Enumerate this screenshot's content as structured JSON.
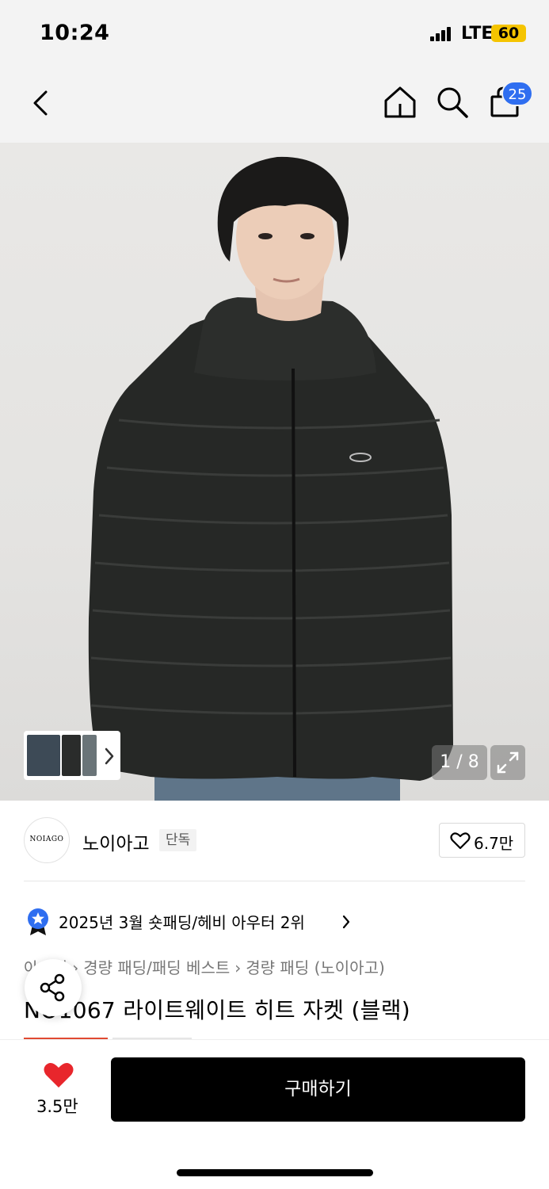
{
  "status_bar": {
    "time": "10:24",
    "network": "LTE",
    "battery": "60",
    "icons": [
      "signal-icon",
      "battery-icon"
    ]
  },
  "nav": {
    "icons": [
      "back-icon",
      "home-icon",
      "search-icon",
      "shopping-bag-icon"
    ],
    "cart_count": "25"
  },
  "gallery": {
    "counter": "1 / 8",
    "icons": [
      "chevron-right-icon",
      "expand-icon"
    ]
  },
  "brand": {
    "logo_text": "NOIAGO",
    "name": "노이아고",
    "tag": "단독",
    "likes": "6.7만"
  },
  "ranking": {
    "text": "2025년 3월 숏패딩/헤비 아우터 2위",
    "icon": "ribbon-badge-icon"
  },
  "breadcrumb": {
    "items": [
      "아우터",
      "경량 패딩/패딩 베스트",
      "경량 패딩 (노이아고)"
    ]
  },
  "product": {
    "title": "NO1067 라이트웨이트 히트 자켓 (블랙)"
  },
  "bottom_bar": {
    "heart_count": "3.5만",
    "buy_label": "구매하기"
  },
  "colors": {
    "accent_blue": "#2f6ef0",
    "heart_red": "#e8262c",
    "buy_black": "#000000",
    "battery_yellow": "#f5c400"
  }
}
